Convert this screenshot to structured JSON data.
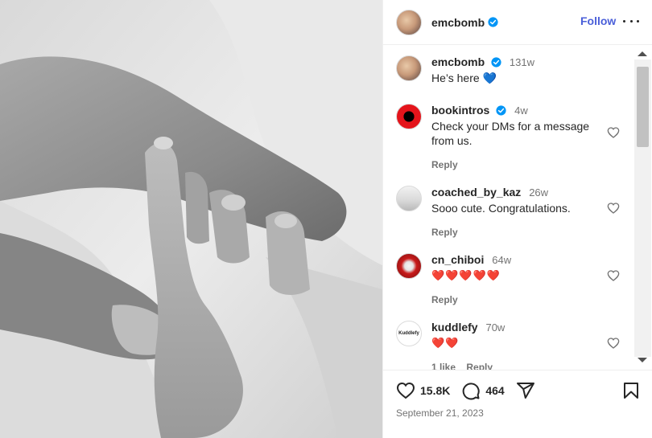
{
  "post": {
    "username": "emcbomb",
    "follow_label": "Follow",
    "caption": "He’s here 💙",
    "caption_age": "131w",
    "likes": "15.8K",
    "comments_count": "464",
    "date": "September 21, 2023"
  },
  "comments": [
    {
      "username": "bookintros",
      "verified": true,
      "age": "4w",
      "text": "Check your DMs for a message from us.",
      "reply_label": "Reply"
    },
    {
      "username": "coached_by_kaz",
      "verified": false,
      "age": "26w",
      "text": "Sooo cute. Congratulations.",
      "reply_label": "Reply"
    },
    {
      "username": "cn_chiboi",
      "verified": false,
      "age": "64w",
      "text": "❤️❤️❤️❤️❤️",
      "reply_label": "Reply"
    },
    {
      "username": "kuddlefy",
      "verified": false,
      "age": "70w",
      "text": "❤️❤️",
      "likes_label": "1 like",
      "reply_label": "Reply"
    }
  ],
  "icons": {
    "verified": "verified-badge-icon",
    "heart": "heart-icon",
    "comment": "comment-icon",
    "share": "share-icon",
    "bookmark": "bookmark-icon",
    "more": "more-options-icon"
  },
  "colors": {
    "follow": "#4a5fd9",
    "verified": "#0095f6",
    "heart_red": "#ed4956"
  }
}
